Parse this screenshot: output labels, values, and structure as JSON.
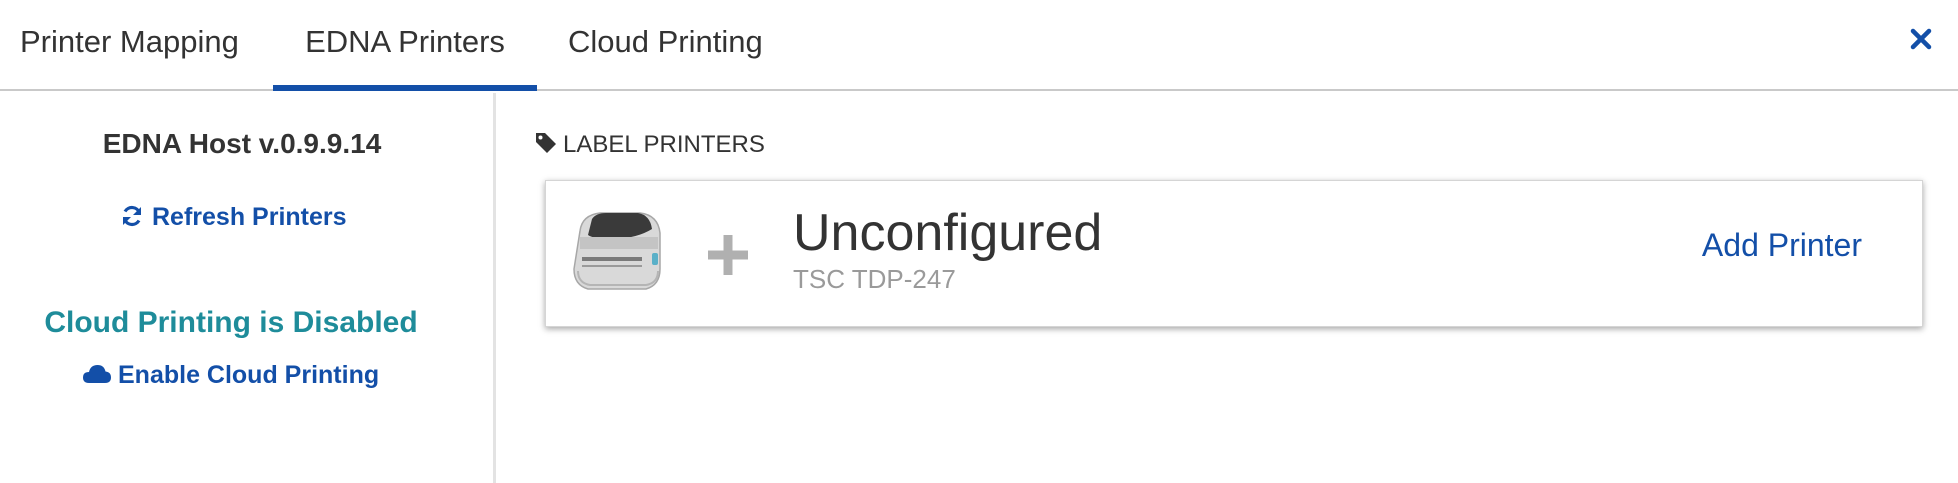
{
  "tabs": {
    "printer_mapping": "Printer Mapping",
    "edna_printers": "EDNA Printers",
    "cloud_printing": "Cloud Printing"
  },
  "sidebar": {
    "host_title": "EDNA Host v.0.9.9.14",
    "refresh_label": "Refresh Printers",
    "cloud_status": "Cloud Printing is Disabled",
    "enable_cloud_label": "Enable Cloud Printing"
  },
  "main": {
    "section_title": "LABEL PRINTERS",
    "printer": {
      "name": "Unconfigured",
      "model": "TSC TDP-247",
      "action_label": "Add Printer"
    }
  },
  "icons": {
    "close": "close-icon",
    "refresh": "refresh-icon",
    "cloud": "cloud-icon",
    "tag": "tag-icon",
    "plus": "plus-icon"
  },
  "colors": {
    "accent": "#134fa8",
    "status_teal": "#1e8c9a",
    "muted_text": "#9a9a9a",
    "text": "#333333"
  }
}
